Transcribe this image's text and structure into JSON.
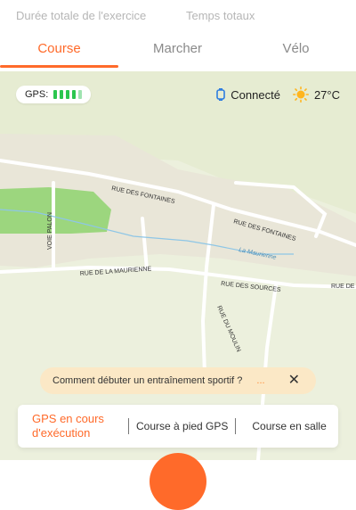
{
  "top_tabs": [
    "Durée totale de l'exercice",
    "Temps totaux"
  ],
  "sport_tabs": {
    "course": "Course",
    "marcher": "Marcher",
    "velo": "Vélo"
  },
  "gps": {
    "label": "GPS:",
    "bars_total": 5,
    "bars_strong": 4
  },
  "status": {
    "connection": "Connecté",
    "temperature": "27°C",
    "watch_icon": "watch-icon",
    "weather_icon": "sun-icon"
  },
  "map": {
    "labels": {
      "rue_fontaines_1": "RUE DES FONTAINES",
      "rue_fontaines_2": "RUE DES FONTAINES",
      "voie_palon": "VOIE PALON",
      "la_maurienne": "La Maurienne",
      "rue_maurienne": "RUE DE LA MAURIENNE",
      "rue_sources": "RUE DES SOURCES",
      "rue_de": "RUE DE",
      "rue_moulin": "RUE DU MOULIN"
    }
  },
  "tip": {
    "text": "Comment débuter un entraînement sportif ?",
    "dots": "...",
    "close": "✕"
  },
  "modes": {
    "gps_run": "GPS en cours d'exécution",
    "outdoor": "Course à pied GPS",
    "indoor": "Course en salle"
  },
  "colors": {
    "accent": "#ff6a2a",
    "gps_green": "#2bc64f",
    "tip_bg": "#fbe8c6"
  }
}
